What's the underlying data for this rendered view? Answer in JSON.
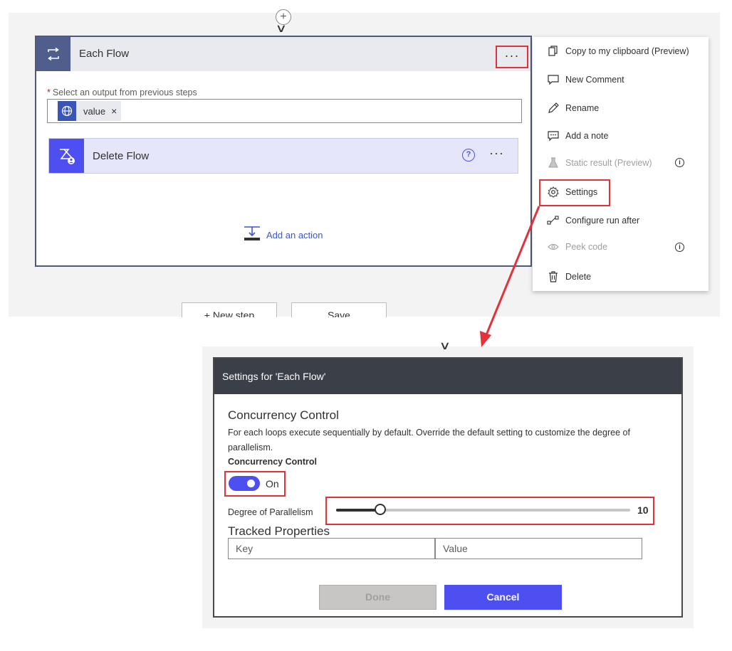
{
  "loop": {
    "title": "Each Flow",
    "ellipsis": "···",
    "select_required_mark": "*",
    "select_label": "Select an output from previous steps",
    "token_value": "value",
    "token_remove": "×",
    "inner_action_title": "Delete Flow",
    "inner_help": "?",
    "inner_ellipsis": "···",
    "add_action_label": "Add an action"
  },
  "bottom_buttons": {
    "new_step_label": "+ New step",
    "save_label": "Save"
  },
  "menu": {
    "items": [
      {
        "label": "Copy to my clipboard (Preview)",
        "icon": "copy-icon",
        "disabled": false
      },
      {
        "label": "New Comment",
        "icon": "comment-icon",
        "disabled": false
      },
      {
        "label": "Rename",
        "icon": "pencil-icon",
        "disabled": false
      },
      {
        "label": "Add a note",
        "icon": "note-icon",
        "disabled": false
      },
      {
        "label": "Static result (Preview)",
        "icon": "flask-icon",
        "disabled": true,
        "info": "i"
      },
      {
        "label": "Settings",
        "icon": "gear-icon",
        "disabled": false
      },
      {
        "label": "Configure run after",
        "icon": "run-after-icon",
        "disabled": false
      },
      {
        "label": "Peek code",
        "icon": "eye-icon",
        "disabled": true,
        "info": "i"
      },
      {
        "label": "Delete",
        "icon": "trash-icon",
        "disabled": false
      }
    ]
  },
  "dialog": {
    "title": "Settings for 'Each Flow'",
    "section_title": "Concurrency Control",
    "description": "For each loops execute sequentially by default. Override the default setting to customize the degree of parallelism.",
    "control_label": "Concurrency Control",
    "toggle_state": "On",
    "parallelism_label": "Degree of Parallelism",
    "parallelism_value": "10",
    "parallelism_fraction": 0.15,
    "tracked_title": "Tracked Properties",
    "key_placeholder": "Key",
    "value_placeholder": "Value",
    "done_label": "Done",
    "cancel_label": "Cancel"
  },
  "colors": {
    "accent": "#4d4ff0",
    "highlight": "#e5323a",
    "dialog_header": "#3b3f48",
    "loop_icon": "#4f5e8c"
  }
}
